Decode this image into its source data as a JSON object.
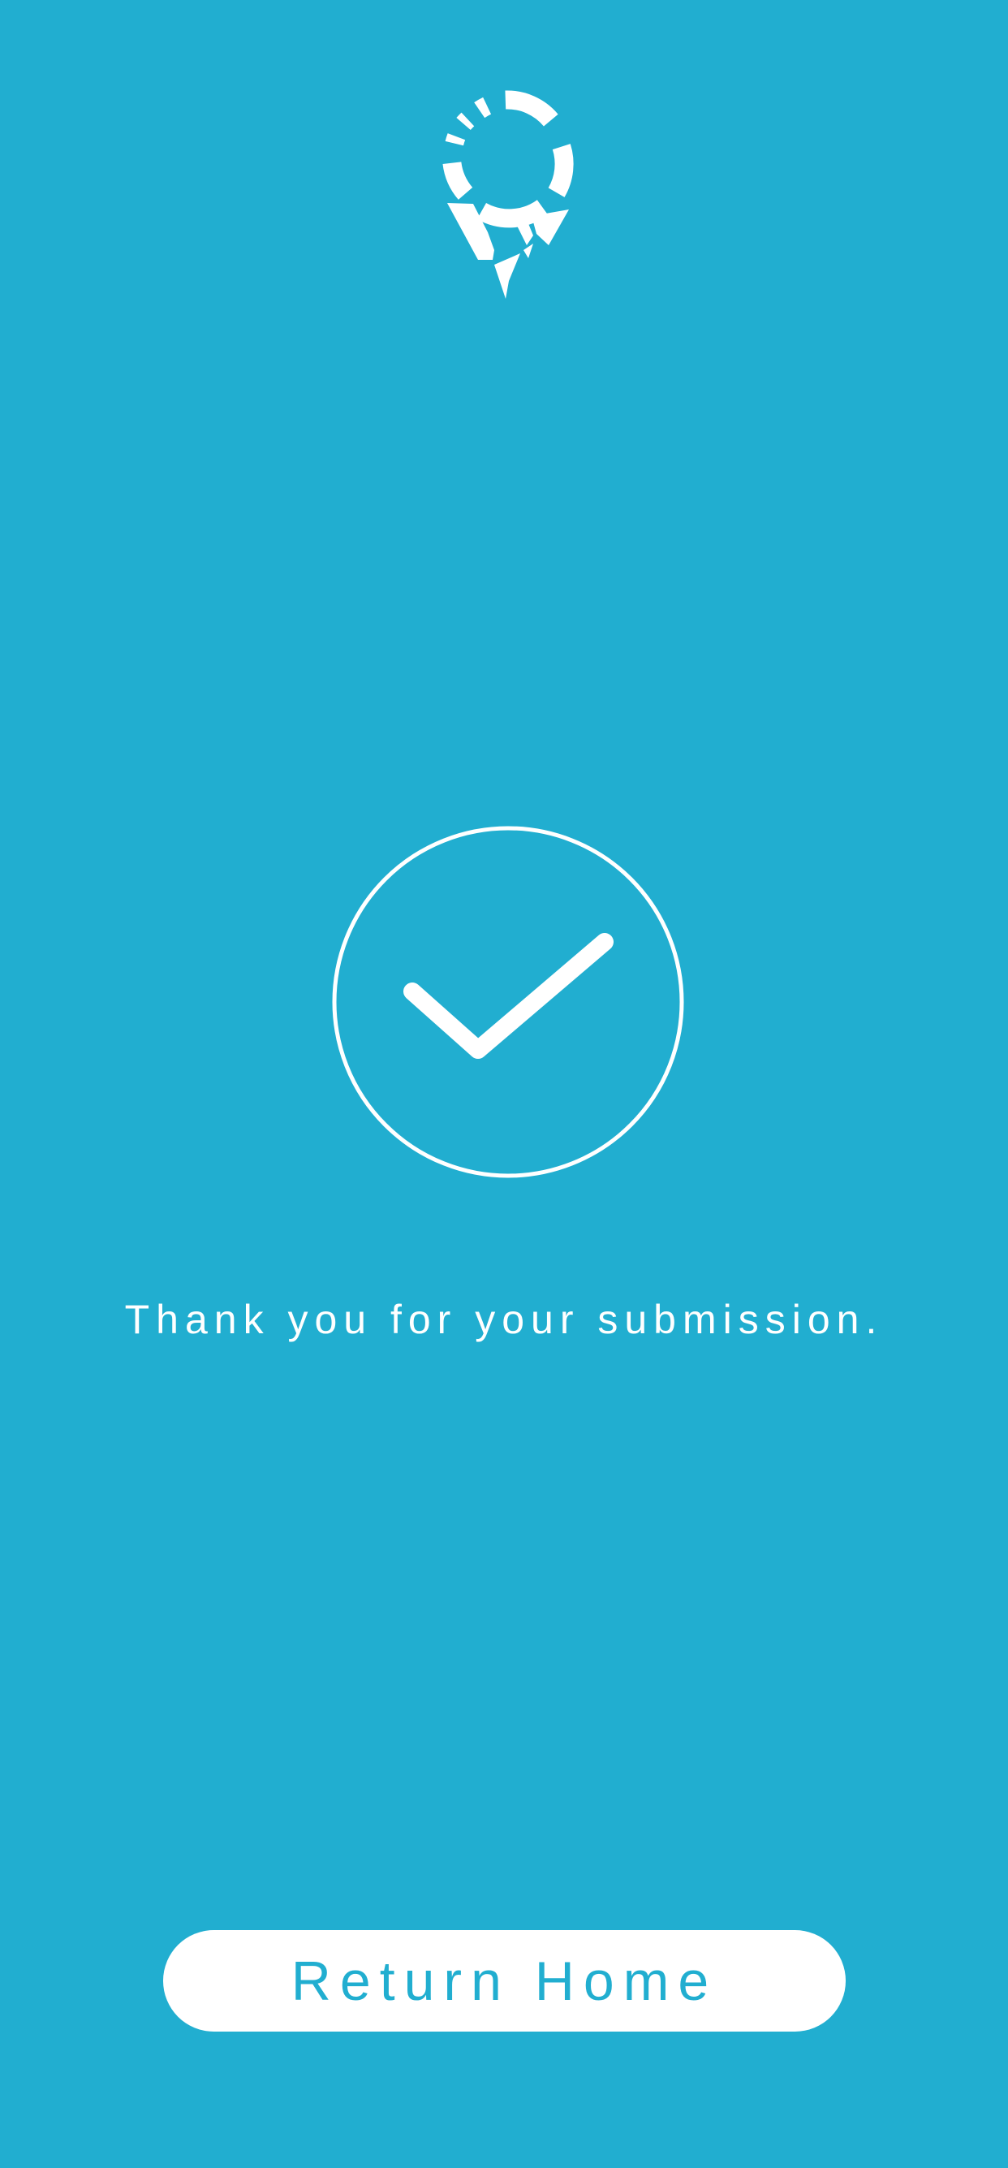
{
  "theme": {
    "background": "#21AED0",
    "foreground": "#FFFFFF"
  },
  "header": {
    "logo_icon": "map-pin-logo-icon"
  },
  "status": {
    "icon": "check-circle-icon",
    "message": "Thank you for your submission."
  },
  "actions": {
    "return_home_label": "Return Home"
  }
}
